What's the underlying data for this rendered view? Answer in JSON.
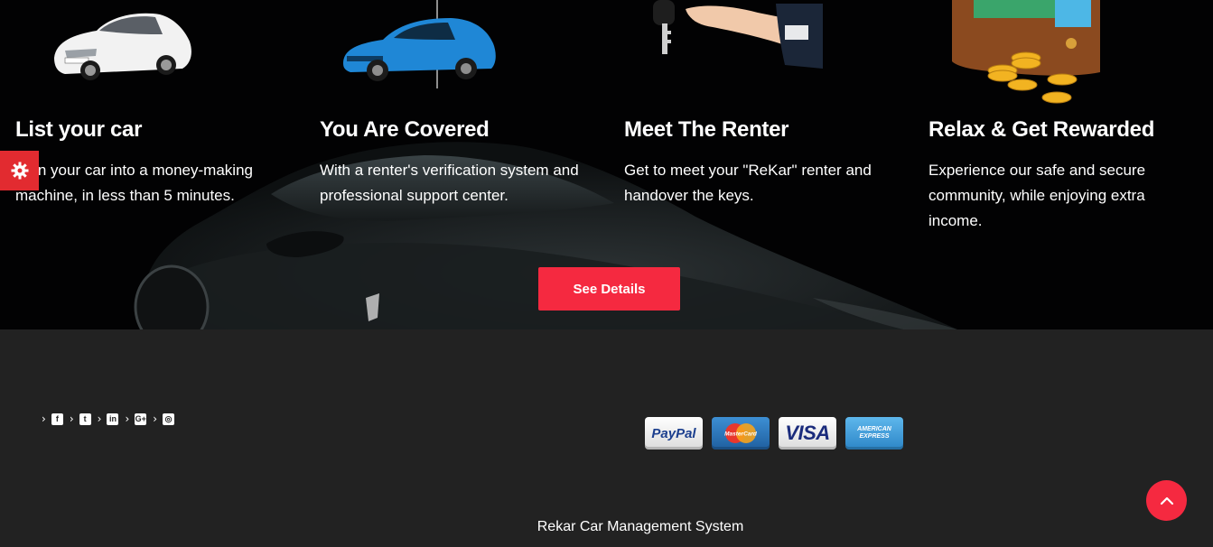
{
  "colors": {
    "accent": "#f52940",
    "hero_background": "#020203",
    "footer_background": "#222222",
    "text": "#ffffff"
  },
  "steps": [
    {
      "title": "List your car",
      "text": "Turn your car into a money-making machine, in less than 5 minutes.",
      "icon": "white-sedan-image"
    },
    {
      "title": "You Are Covered",
      "text": "With a renter's verification system and professional support center.",
      "icon": "blue-car-image"
    },
    {
      "title": "Meet The Renter",
      "text": "Get to meet your \"ReKar\" renter and handover the keys.",
      "icon": "car-key-hand-image"
    },
    {
      "title": "Relax & Get Rewarded",
      "text": "Experience our safe and secure community, while enjoying extra income.",
      "icon": "wallet-coins-image"
    }
  ],
  "cta": {
    "label": "See Details"
  },
  "settings": {
    "icon": "gear-icon"
  },
  "social": [
    {
      "icon": "facebook-icon",
      "glyph": "f"
    },
    {
      "icon": "twitter-icon",
      "glyph": "t"
    },
    {
      "icon": "linkedin-icon",
      "glyph": "in"
    },
    {
      "icon": "google-plus-icon",
      "glyph": "G+"
    },
    {
      "icon": "instagram-icon",
      "glyph": "◎"
    }
  ],
  "payments": {
    "paypal": "PayPal",
    "mastercard": "MasterCard",
    "visa": "VISA",
    "amex_line1": "AMERICAN",
    "amex_line2": "EXPRESS"
  },
  "footer": {
    "copyright": "Rekar Car Management System"
  },
  "scroll_top": {
    "icon": "chevron-up-icon"
  }
}
